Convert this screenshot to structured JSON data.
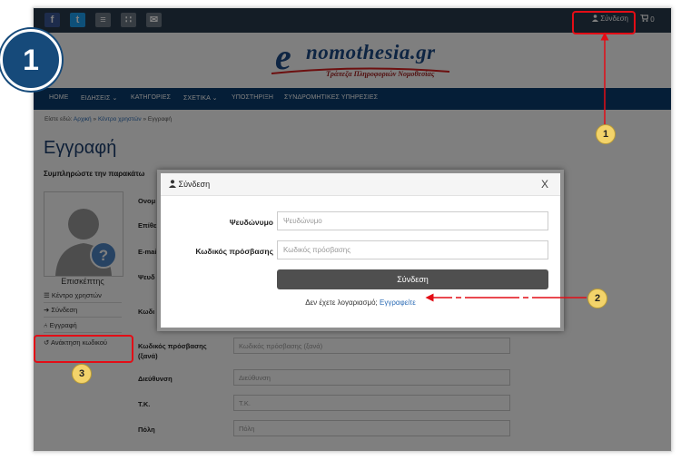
{
  "header": {
    "social": [
      {
        "icon": "facebook-icon",
        "glyph": "f",
        "color": "#3b5998"
      },
      {
        "icon": "twitter-icon",
        "glyph": "t",
        "color": "#1da1f2"
      },
      {
        "icon": "rss-icon",
        "glyph": "≡",
        "color": "#6f7b87"
      },
      {
        "icon": "sitemap-icon",
        "glyph": "∷",
        "color": "#6f7b87"
      },
      {
        "icon": "email-icon",
        "glyph": "✉",
        "color": "#6f7b87"
      }
    ],
    "login_label": "Σύνδεση",
    "cart_count": "0"
  },
  "logo": {
    "brand_text": "nomothesia.gr",
    "brand_letter": "e",
    "subtitle": "Τράπεζα Πληροφοριών Νομοθεσίας"
  },
  "nav": {
    "items": [
      "HOME",
      "ΕΙΔΗΣΕΙΣ ⌄",
      "ΚΑΤΗΓΟΡΙΕΣ",
      "ΣΧΕΤΙΚΑ ⌄",
      "ΥΠΟΣΤΗΡΙΞΗ",
      "ΣΥΝΔΡΟΜΗΤΙΚΕΣ ΥΠΗΡΕΣΙΕΣ"
    ]
  },
  "breadcrumb": {
    "prefix": "Είστε εδώ:",
    "home": "Αρχική",
    "sep": "»",
    "center": "Κέντρο χρηστών",
    "current": "Εγγραφή"
  },
  "page": {
    "title": "Εγγραφή",
    "intro": "Συμπληρώστε την παρακάτω"
  },
  "sidebar": {
    "visitor": "Επισκέπτης",
    "items": [
      {
        "label": "Κέντρο χρηστών",
        "glyph": "☰"
      },
      {
        "label": "Σύνδεση",
        "glyph": "➜"
      },
      {
        "label": "Εγγραφή",
        "glyph": "⑃"
      },
      {
        "label": "Ανάκτηση κωδικού",
        "glyph": "↺"
      }
    ]
  },
  "form": {
    "partial_labels": [
      "Ονομ",
      "Επίθε",
      "E-mai",
      "Ψευδ",
      "Κωδι"
    ],
    "fields": [
      {
        "label": "Κωδικός πρόσβασης (ξανά)",
        "placeholder": "Κωδικός πρόσβασης (ξανά)"
      },
      {
        "label": "Διεύθυνση",
        "placeholder": "Διεύθυνση"
      },
      {
        "label": "Τ.Κ.",
        "placeholder": "Τ.Κ."
      },
      {
        "label": "Πόλη",
        "placeholder": "Πόλη"
      }
    ]
  },
  "modal": {
    "title": "Σύνδεση",
    "close": "X",
    "username_label": "Ψευδώνυμο",
    "username_placeholder": "Ψευδώνυμο",
    "password_label": "Κωδικός πρόσβασης",
    "password_placeholder": "Κωδικός πρόσβασης",
    "submit": "Σύνδεση",
    "footer_text": "Δεν έχετε λογαριασμό;",
    "register_link": "Εγγραφείτε"
  },
  "annotations": {
    "step_big": "1",
    "marker_1": "1",
    "marker_2": "2",
    "marker_3": "3",
    "highlight_color": "#e30d16"
  }
}
